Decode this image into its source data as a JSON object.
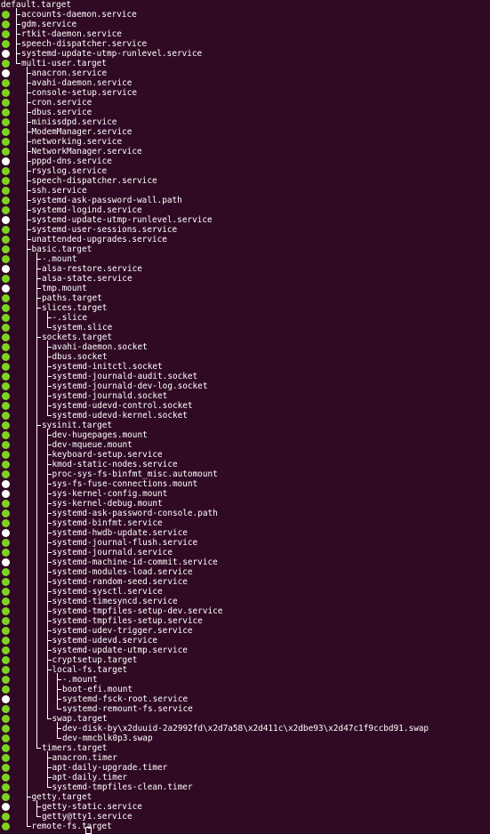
{
  "terminal": {
    "root": "default.target",
    "items": [
      {
        "label": "accounts-daemon.service",
        "depth": 1,
        "status": "green",
        "last": false
      },
      {
        "label": "gdm.service",
        "depth": 1,
        "status": "green",
        "last": false
      },
      {
        "label": "rtkit-daemon.service",
        "depth": 1,
        "status": "green",
        "last": false
      },
      {
        "label": "speech-dispatcher.service",
        "depth": 1,
        "status": "green",
        "last": false
      },
      {
        "label": "systemd-update-utmp-runlevel.service",
        "depth": 1,
        "status": "white",
        "last": false
      },
      {
        "label": "multi-user.target",
        "depth": 1,
        "status": "green",
        "last": true
      },
      {
        "label": "anacron.service",
        "depth": 2,
        "status": "white",
        "last": false
      },
      {
        "label": "avahi-daemon.service",
        "depth": 2,
        "status": "green",
        "last": false
      },
      {
        "label": "console-setup.service",
        "depth": 2,
        "status": "green",
        "last": false
      },
      {
        "label": "cron.service",
        "depth": 2,
        "status": "green",
        "last": false
      },
      {
        "label": "dbus.service",
        "depth": 2,
        "status": "green",
        "last": false
      },
      {
        "label": "minissdpd.service",
        "depth": 2,
        "status": "green",
        "last": false
      },
      {
        "label": "ModemManager.service",
        "depth": 2,
        "status": "green",
        "last": false
      },
      {
        "label": "networking.service",
        "depth": 2,
        "status": "green",
        "last": false
      },
      {
        "label": "NetworkManager.service",
        "depth": 2,
        "status": "green",
        "last": false
      },
      {
        "label": "pppd-dns.service",
        "depth": 2,
        "status": "white",
        "last": false
      },
      {
        "label": "rsyslog.service",
        "depth": 2,
        "status": "green",
        "last": false
      },
      {
        "label": "speech-dispatcher.service",
        "depth": 2,
        "status": "green",
        "last": false
      },
      {
        "label": "ssh.service",
        "depth": 2,
        "status": "green",
        "last": false
      },
      {
        "label": "systemd-ask-password-wall.path",
        "depth": 2,
        "status": "green",
        "last": false
      },
      {
        "label": "systemd-logind.service",
        "depth": 2,
        "status": "green",
        "last": false
      },
      {
        "label": "systemd-update-utmp-runlevel.service",
        "depth": 2,
        "status": "white",
        "last": false
      },
      {
        "label": "systemd-user-sessions.service",
        "depth": 2,
        "status": "green",
        "last": false
      },
      {
        "label": "unattended-upgrades.service",
        "depth": 2,
        "status": "green",
        "last": false
      },
      {
        "label": "basic.target",
        "depth": 2,
        "status": "green",
        "last": false
      },
      {
        "label": "-.mount",
        "depth": 3,
        "status": "green",
        "last": false
      },
      {
        "label": "alsa-restore.service",
        "depth": 3,
        "status": "white",
        "last": false
      },
      {
        "label": "alsa-state.service",
        "depth": 3,
        "status": "green",
        "last": false
      },
      {
        "label": "tmp.mount",
        "depth": 3,
        "status": "white",
        "last": false
      },
      {
        "label": "paths.target",
        "depth": 3,
        "status": "green",
        "last": false
      },
      {
        "label": "slices.target",
        "depth": 3,
        "status": "green",
        "last": false
      },
      {
        "label": "-.slice",
        "depth": 4,
        "status": "green",
        "last": false
      },
      {
        "label": "system.slice",
        "depth": 4,
        "status": "green",
        "last": true
      },
      {
        "label": "sockets.target",
        "depth": 3,
        "status": "green",
        "last": false
      },
      {
        "label": "avahi-daemon.socket",
        "depth": 4,
        "status": "green",
        "last": false
      },
      {
        "label": "dbus.socket",
        "depth": 4,
        "status": "green",
        "last": false
      },
      {
        "label": "systemd-initctl.socket",
        "depth": 4,
        "status": "green",
        "last": false
      },
      {
        "label": "systemd-journald-audit.socket",
        "depth": 4,
        "status": "green",
        "last": false
      },
      {
        "label": "systemd-journald-dev-log.socket",
        "depth": 4,
        "status": "green",
        "last": false
      },
      {
        "label": "systemd-journald.socket",
        "depth": 4,
        "status": "green",
        "last": false
      },
      {
        "label": "systemd-udevd-control.socket",
        "depth": 4,
        "status": "green",
        "last": false
      },
      {
        "label": "systemd-udevd-kernel.socket",
        "depth": 4,
        "status": "green",
        "last": true
      },
      {
        "label": "sysinit.target",
        "depth": 3,
        "status": "green",
        "last": false
      },
      {
        "label": "dev-hugepages.mount",
        "depth": 4,
        "status": "green",
        "last": false
      },
      {
        "label": "dev-mqueue.mount",
        "depth": 4,
        "status": "green",
        "last": false
      },
      {
        "label": "keyboard-setup.service",
        "depth": 4,
        "status": "green",
        "last": false
      },
      {
        "label": "kmod-static-nodes.service",
        "depth": 4,
        "status": "green",
        "last": false
      },
      {
        "label": "proc-sys-fs-binfmt_misc.automount",
        "depth": 4,
        "status": "green",
        "last": false
      },
      {
        "label": "sys-fs-fuse-connections.mount",
        "depth": 4,
        "status": "white",
        "last": false
      },
      {
        "label": "sys-kernel-config.mount",
        "depth": 4,
        "status": "white",
        "last": false
      },
      {
        "label": "sys-kernel-debug.mount",
        "depth": 4,
        "status": "green",
        "last": false
      },
      {
        "label": "systemd-ask-password-console.path",
        "depth": 4,
        "status": "green",
        "last": false
      },
      {
        "label": "systemd-binfmt.service",
        "depth": 4,
        "status": "green",
        "last": false
      },
      {
        "label": "systemd-hwdb-update.service",
        "depth": 4,
        "status": "white",
        "last": false
      },
      {
        "label": "systemd-journal-flush.service",
        "depth": 4,
        "status": "green",
        "last": false
      },
      {
        "label": "systemd-journald.service",
        "depth": 4,
        "status": "green",
        "last": false
      },
      {
        "label": "systemd-machine-id-commit.service",
        "depth": 4,
        "status": "white",
        "last": false
      },
      {
        "label": "systemd-modules-load.service",
        "depth": 4,
        "status": "green",
        "last": false
      },
      {
        "label": "systemd-random-seed.service",
        "depth": 4,
        "status": "green",
        "last": false
      },
      {
        "label": "systemd-sysctl.service",
        "depth": 4,
        "status": "green",
        "last": false
      },
      {
        "label": "systemd-timesyncd.service",
        "depth": 4,
        "status": "green",
        "last": false
      },
      {
        "label": "systemd-tmpfiles-setup-dev.service",
        "depth": 4,
        "status": "green",
        "last": false
      },
      {
        "label": "systemd-tmpfiles-setup.service",
        "depth": 4,
        "status": "green",
        "last": false
      },
      {
        "label": "systemd-udev-trigger.service",
        "depth": 4,
        "status": "green",
        "last": false
      },
      {
        "label": "systemd-udevd.service",
        "depth": 4,
        "status": "green",
        "last": false
      },
      {
        "label": "systemd-update-utmp.service",
        "depth": 4,
        "status": "green",
        "last": false
      },
      {
        "label": "cryptsetup.target",
        "depth": 4,
        "status": "green",
        "last": false
      },
      {
        "label": "local-fs.target",
        "depth": 4,
        "status": "green",
        "last": false
      },
      {
        "label": "-.mount",
        "depth": 5,
        "status": "green",
        "last": false
      },
      {
        "label": "boot-efi.mount",
        "depth": 5,
        "status": "green",
        "last": false
      },
      {
        "label": "systemd-fsck-root.service",
        "depth": 5,
        "status": "white",
        "last": false
      },
      {
        "label": "systemd-remount-fs.service",
        "depth": 5,
        "status": "green",
        "last": true
      },
      {
        "label": "swap.target",
        "depth": 4,
        "status": "green",
        "last": true
      },
      {
        "label": "dev-disk-by\\x2duuid-2a2992fd\\x2d7a58\\x2d411c\\x2dbe93\\x2d47c1f9ccbd91.swap",
        "depth": 5,
        "status": "green",
        "last": false
      },
      {
        "label": "dev-mmcblk0p3.swap",
        "depth": 5,
        "status": "green",
        "last": true
      },
      {
        "label": "timers.target",
        "depth": 3,
        "status": "green",
        "last": true
      },
      {
        "label": "anacron.timer",
        "depth": 4,
        "status": "green",
        "last": false
      },
      {
        "label": "apt-daily-upgrade.timer",
        "depth": 4,
        "status": "green",
        "last": false
      },
      {
        "label": "apt-daily.timer",
        "depth": 4,
        "status": "green",
        "last": false
      },
      {
        "label": "systemd-tmpfiles-clean.timer",
        "depth": 4,
        "status": "green",
        "last": true
      },
      {
        "label": "getty.target",
        "depth": 2,
        "status": "green",
        "last": false
      },
      {
        "label": "getty-static.service",
        "depth": 3,
        "status": "white",
        "last": false
      },
      {
        "label": "getty@tty1.service",
        "depth": 3,
        "status": "green",
        "last": true
      },
      {
        "label": "remote-fs.target",
        "depth": 2,
        "status": "green",
        "last": true
      }
    ]
  },
  "colors": {
    "background": "#300a24",
    "active": "#7dd321",
    "inactive": "#ffffff",
    "text": "#ffffff"
  }
}
